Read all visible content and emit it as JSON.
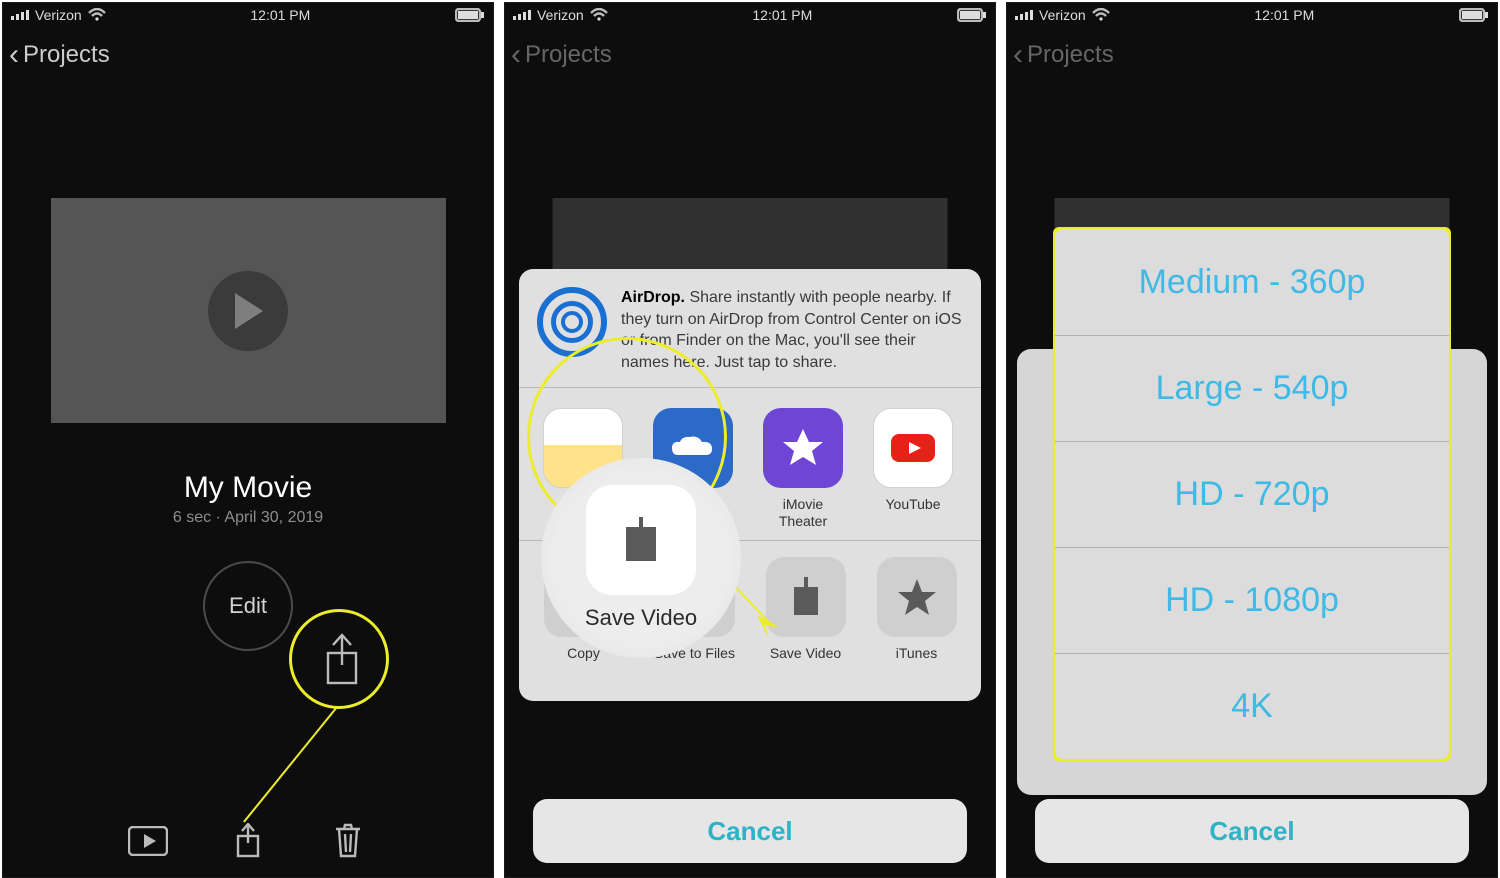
{
  "status": {
    "carrier": "Verizon",
    "time": "12:01 PM"
  },
  "nav": {
    "back": "Projects"
  },
  "screen1": {
    "title": "My Movie",
    "meta": "6 sec · April 30, 2019",
    "edit": "Edit"
  },
  "screen2": {
    "airdrop_bold": "AirDrop.",
    "airdrop_text": " Share instantly with people nearby. If they turn on AirDrop from Control Center on iOS or from Finder on the Mac, you'll see their names here. Just tap to share.",
    "apps": {
      "notes": "Add to Notes",
      "onedrive": "OneDrive",
      "imovie": "iMovie Theater",
      "youtube": "YouTube"
    },
    "actions": {
      "copy": "Copy",
      "savefiles": "Save to Files",
      "savevideo": "Save Video",
      "itunes": "iTunes"
    },
    "callout_label": "Save Video",
    "cancel": "Cancel"
  },
  "screen3": {
    "options": {
      "o1": "Medium - 360p",
      "o2": "Large - 540p",
      "o3": "HD - 720p",
      "o4": "HD - 1080p",
      "o5": "4K"
    },
    "cancel": "Cancel"
  }
}
